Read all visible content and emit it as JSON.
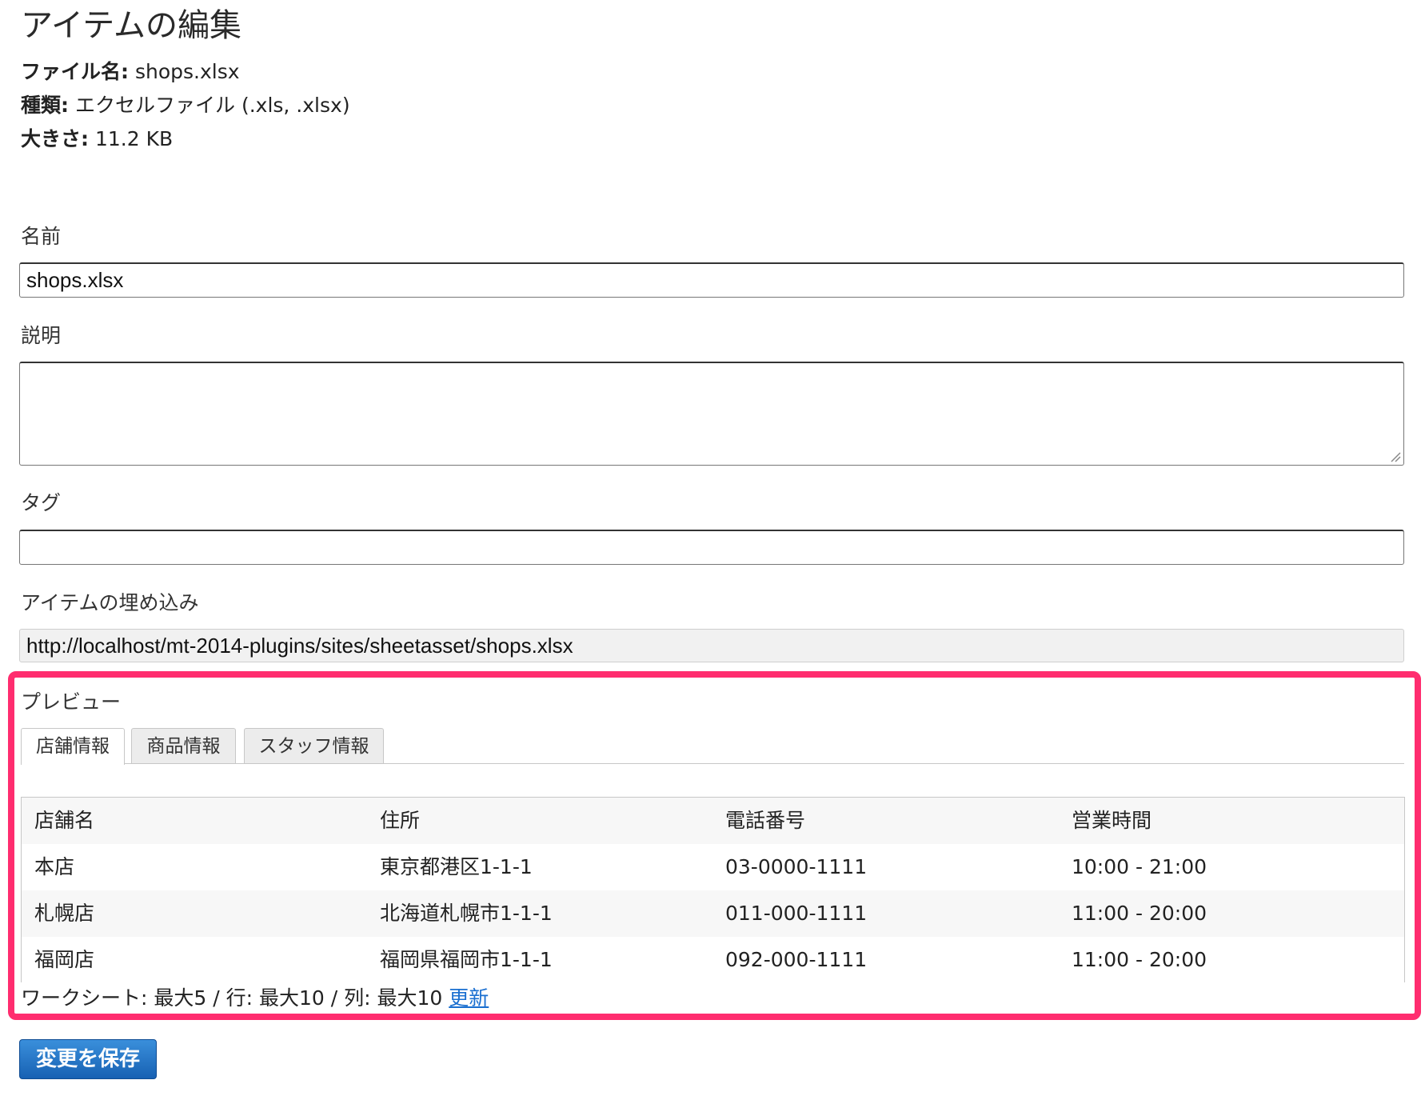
{
  "page": {
    "title": "アイテムの編集"
  },
  "file_info": {
    "filename_label": "ファイル名:",
    "filename_value": "shops.xlsx",
    "type_label": "種類:",
    "type_value": "エクセルファイル (.xls, .xlsx)",
    "size_label": "大きさ:",
    "size_value": "11.2 KB"
  },
  "form": {
    "name_label": "名前",
    "name_value": "shops.xlsx",
    "description_label": "説明",
    "description_value": "",
    "tags_label": "タグ",
    "tags_value": "",
    "embed_label": "アイテムの埋め込み",
    "embed_value": "http://localhost/mt-2014-plugins/sites/sheetasset/shops.xlsx"
  },
  "preview": {
    "label": "プレビュー",
    "tabs": [
      {
        "label": "店舗情報",
        "active": true
      },
      {
        "label": "商品情報",
        "active": false
      },
      {
        "label": "スタッフ情報",
        "active": false
      }
    ],
    "table": {
      "headers": [
        "店舗名",
        "住所",
        "電話番号",
        "営業時間"
      ],
      "rows": [
        [
          "本店",
          "東京都港区1-1-1",
          "03-0000-1111",
          "10:00 - 21:00"
        ],
        [
          "札幌店",
          "北海道札幌市1-1-1",
          "011-000-1111",
          "11:00 - 20:00"
        ],
        [
          "福岡店",
          "福岡県福岡市1-1-1",
          "092-000-1111",
          "11:00 - 20:00"
        ]
      ]
    },
    "limits_text": "ワークシート: 最大5 / 行: 最大10 / 列: 最大10",
    "refresh_link": "更新",
    "highlight_color": "#ff2d6f"
  },
  "actions": {
    "save_label": "変更を保存"
  }
}
